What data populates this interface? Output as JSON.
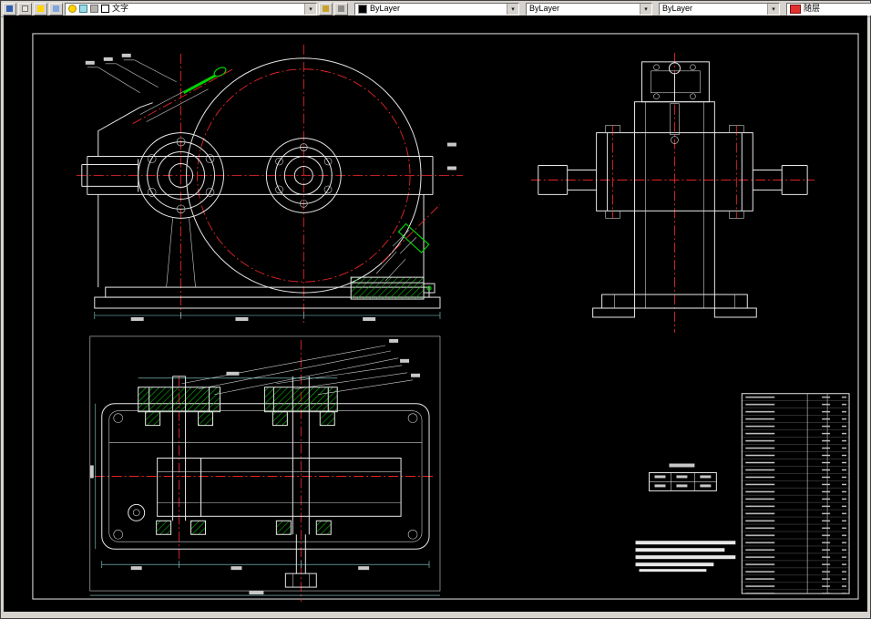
{
  "toolbar": {
    "layer_control": {
      "value": "文字"
    },
    "color_control": {
      "value": "ByLayer",
      "swatch": "#000000"
    },
    "linetype_control": {
      "value": "ByLayer"
    },
    "lineweight_control": {
      "value": "ByLayer"
    },
    "plotstyle_control": {
      "value": "随层",
      "swatch": "#ff0000"
    }
  },
  "colors": {
    "canvas_background": "#000000",
    "object_lines": "#e8e8e8",
    "centerlines": "#ff2a2a",
    "highlight_fittings": "#00d200",
    "hatch": "#00c800",
    "dimensions": "#8fd8d8",
    "toolbar_background": "#d6d3ce"
  }
}
